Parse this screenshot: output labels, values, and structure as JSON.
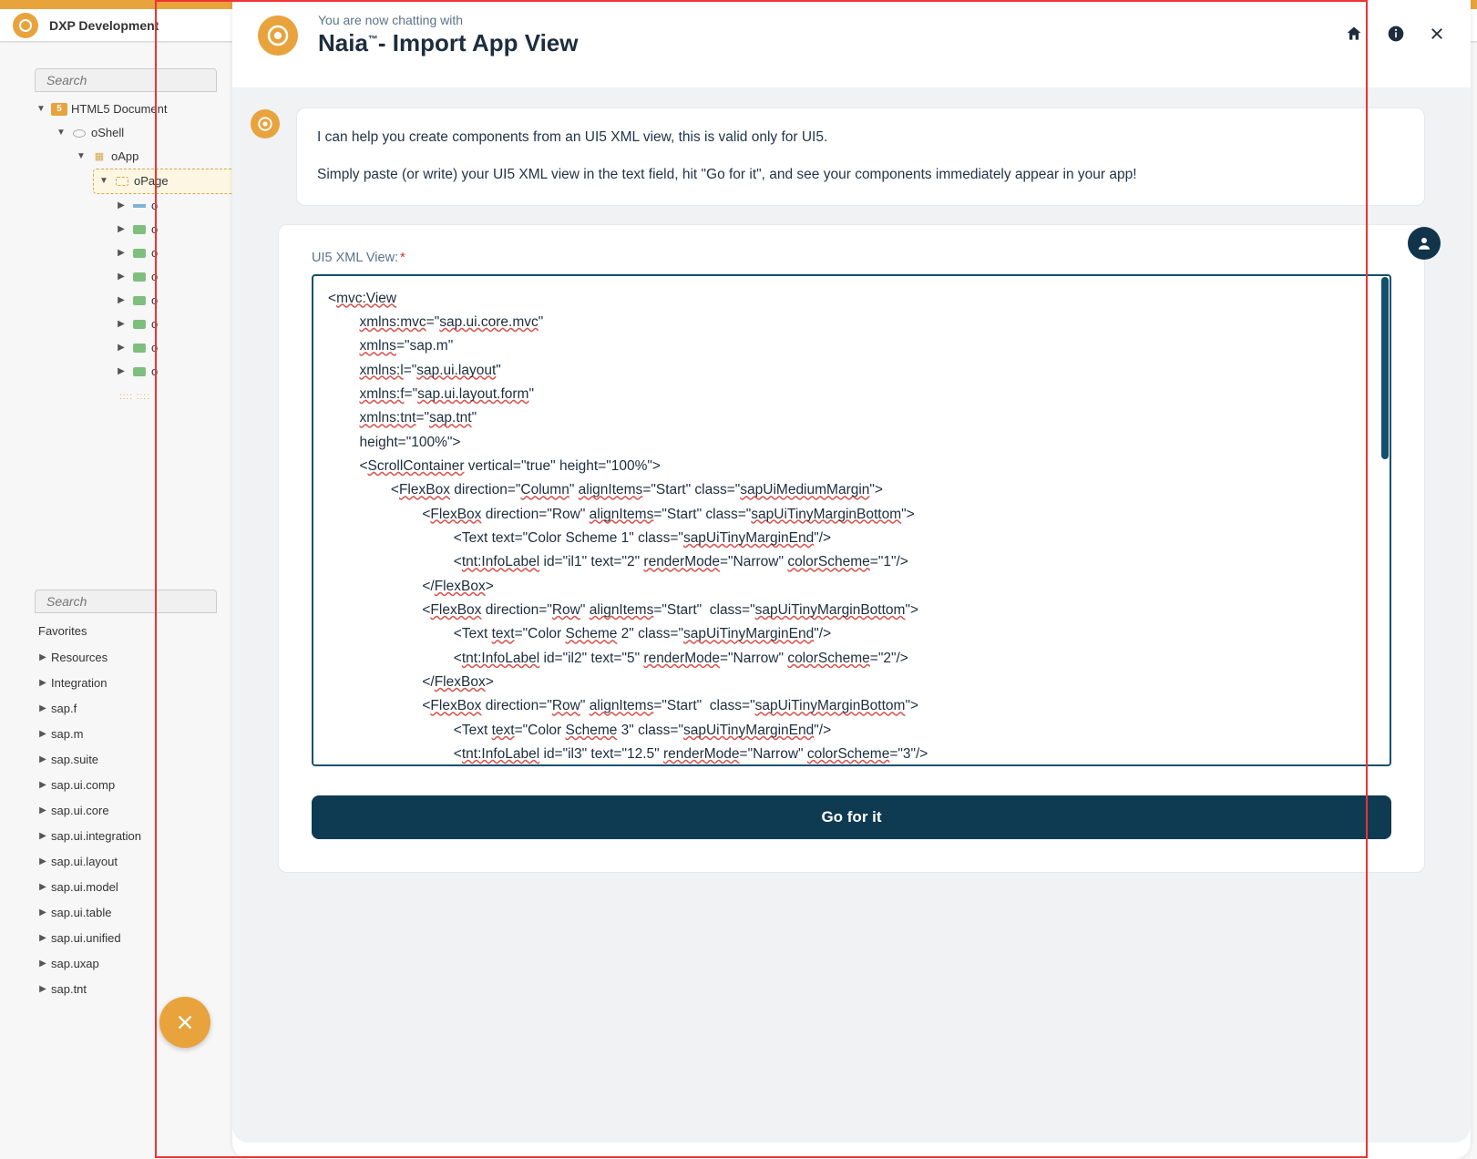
{
  "header": {
    "brand": "DXP Development"
  },
  "sidebar": {
    "search_placeholder": "Search",
    "tree": {
      "root": "HTML5 Document",
      "shell": "oShell",
      "app": "oApp",
      "page": "oPage",
      "children": [
        "o",
        "o",
        "o",
        "o",
        "o",
        "o",
        "o",
        "o"
      ]
    }
  },
  "favorites": {
    "search_placeholder": "Search",
    "heading": "Favorites",
    "items": [
      "Resources",
      "Integration",
      "sap.f",
      "sap.m",
      "sap.suite",
      "sap.ui.comp",
      "sap.ui.core",
      "sap.ui.integration",
      "sap.ui.layout",
      "sap.ui.model",
      "sap.ui.table",
      "sap.ui.unified",
      "sap.uxap",
      "sap.tnt"
    ]
  },
  "dialog": {
    "subtitle": "You are now chatting with",
    "title_a": "Naia",
    "title_tm": "™",
    "title_b": "- Import App View",
    "intro_p1": "I can help you create components from an UI5 XML view, this is valid only for UI5.",
    "intro_p2": "Simply paste (or write) your UI5 XML view in the text field, hit \"Go for it\", and see your components immediately appear in your app!",
    "form_label": "UI5 XML View:",
    "go_label": "Go for it",
    "xml_lines": [
      {
        "ind": 0,
        "seg": [
          {
            "t": "<"
          },
          {
            "t": "mvc:View",
            "u": 1
          }
        ]
      },
      {
        "ind": 2,
        "seg": [
          {
            "t": "xmlns:mvc",
            "u": 1
          },
          {
            "t": "=\""
          },
          {
            "t": "sap.ui.core.mvc",
            "u": 1
          },
          {
            "t": "\""
          }
        ]
      },
      {
        "ind": 2,
        "seg": [
          {
            "t": "xmlns",
            "u": 1
          },
          {
            "t": "=\"sap.m\""
          }
        ]
      },
      {
        "ind": 2,
        "seg": [
          {
            "t": "xmlns:l",
            "u": 1
          },
          {
            "t": "=\""
          },
          {
            "t": "sap.ui.layout",
            "u": 1
          },
          {
            "t": "\""
          }
        ]
      },
      {
        "ind": 2,
        "seg": [
          {
            "t": "xmlns:f",
            "u": 1
          },
          {
            "t": "=\""
          },
          {
            "t": "sap.ui.layout.form",
            "u": 1
          },
          {
            "t": "\""
          }
        ]
      },
      {
        "ind": 2,
        "seg": [
          {
            "t": "xmlns:tnt",
            "u": 1
          },
          {
            "t": "=\""
          },
          {
            "t": "sap.tnt",
            "u": 1
          },
          {
            "t": "\""
          }
        ]
      },
      {
        "ind": 2,
        "seg": [
          {
            "t": "height=\"100%\">"
          }
        ]
      },
      {
        "ind": 2,
        "seg": [
          {
            "t": "<"
          },
          {
            "t": "ScrollContainer",
            "u": 1
          },
          {
            "t": " vertical=\"true\" height=\"100%\">"
          }
        ]
      },
      {
        "ind": 4,
        "seg": [
          {
            "t": "<"
          },
          {
            "t": "FlexBox",
            "u": 1
          },
          {
            "t": " direction=\""
          },
          {
            "t": "Column",
            "u": 1
          },
          {
            "t": "\" "
          },
          {
            "t": "alignItems",
            "u": 1
          },
          {
            "t": "=\"Start\" class=\""
          },
          {
            "t": "sapUiMediumMargin",
            "u": 1
          },
          {
            "t": "\">"
          }
        ]
      },
      {
        "ind": 6,
        "seg": [
          {
            "t": "<"
          },
          {
            "t": "FlexBox",
            "u": 1
          },
          {
            "t": " direction=\"Row\" "
          },
          {
            "t": "alignItems",
            "u": 1
          },
          {
            "t": "=\"Start\" class=\""
          },
          {
            "t": "sapUiTinyMarginBottom",
            "u": 1
          },
          {
            "t": "\">"
          }
        ]
      },
      {
        "ind": 8,
        "seg": [
          {
            "t": "<Text text=\"Color Scheme 1\" class=\""
          },
          {
            "t": "sapUiTinyMarginEnd",
            "u": 1
          },
          {
            "t": "\"/>"
          }
        ]
      },
      {
        "ind": 8,
        "seg": [
          {
            "t": "<"
          },
          {
            "t": "tnt:InfoLabel",
            "u": 1
          },
          {
            "t": " id=\"il1\" text=\"2\" "
          },
          {
            "t": "renderMode",
            "u": 1
          },
          {
            "t": "=\"Narrow\" "
          },
          {
            "t": "colorScheme",
            "u": 1
          },
          {
            "t": "=\"1\"/>"
          }
        ]
      },
      {
        "ind": 6,
        "seg": [
          {
            "t": "</"
          },
          {
            "t": "FlexBox",
            "u": 1
          },
          {
            "t": ">"
          }
        ]
      },
      {
        "ind": 6,
        "seg": [
          {
            "t": "<"
          },
          {
            "t": "FlexBox",
            "u": 1
          },
          {
            "t": " direction=\""
          },
          {
            "t": "Row",
            "u": 1
          },
          {
            "t": "\" "
          },
          {
            "t": "alignItems",
            "u": 1
          },
          {
            "t": "=\"Start\"  class=\""
          },
          {
            "t": "sapUiTinyMarginBottom",
            "u": 1
          },
          {
            "t": "\">"
          }
        ]
      },
      {
        "ind": 8,
        "seg": [
          {
            "t": "<Text "
          },
          {
            "t": "text",
            "u": 1
          },
          {
            "t": "=\"Color "
          },
          {
            "t": "Scheme",
            "u": 1
          },
          {
            "t": " 2\" class=\""
          },
          {
            "t": "sapUiTinyMarginEnd",
            "u": 1
          },
          {
            "t": "\"/>"
          }
        ]
      },
      {
        "ind": 8,
        "seg": [
          {
            "t": "<"
          },
          {
            "t": "tnt:InfoLabel",
            "u": 1
          },
          {
            "t": " id=\"il2\" text=\"5\" "
          },
          {
            "t": "renderMode",
            "u": 1
          },
          {
            "t": "=\"Narrow\" "
          },
          {
            "t": "colorScheme",
            "u": 1
          },
          {
            "t": "=\"2\"/>"
          }
        ]
      },
      {
        "ind": 6,
        "seg": [
          {
            "t": "</"
          },
          {
            "t": "FlexBox",
            "u": 1
          },
          {
            "t": ">"
          }
        ]
      },
      {
        "ind": 6,
        "seg": [
          {
            "t": "<"
          },
          {
            "t": "FlexBox",
            "u": 1
          },
          {
            "t": " direction=\""
          },
          {
            "t": "Row",
            "u": 1
          },
          {
            "t": "\" "
          },
          {
            "t": "alignItems",
            "u": 1
          },
          {
            "t": "=\"Start\"  class=\""
          },
          {
            "t": "sapUiTinyMarginBottom",
            "u": 1
          },
          {
            "t": "\">"
          }
        ]
      },
      {
        "ind": 8,
        "seg": [
          {
            "t": "<Text "
          },
          {
            "t": "text",
            "u": 1
          },
          {
            "t": "=\"Color "
          },
          {
            "t": "Scheme",
            "u": 1
          },
          {
            "t": " 3\" class=\""
          },
          {
            "t": "sapUiTinyMarginEnd",
            "u": 1
          },
          {
            "t": "\"/>"
          }
        ]
      },
      {
        "ind": 8,
        "seg": [
          {
            "t": "<"
          },
          {
            "t": "tnt:InfoLabel",
            "u": 1
          },
          {
            "t": " id=\"il3\" text=\"12.5\" "
          },
          {
            "t": "renderMode",
            "u": 1
          },
          {
            "t": "=\"Narrow\" "
          },
          {
            "t": "colorScheme",
            "u": 1
          },
          {
            "t": "=\"3\"/>"
          }
        ]
      }
    ]
  }
}
